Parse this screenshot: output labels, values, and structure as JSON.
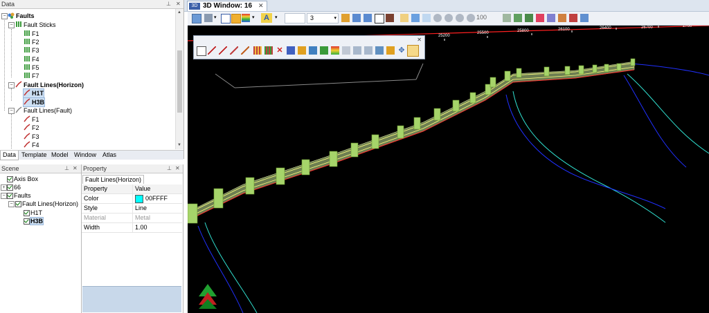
{
  "data_panel": {
    "title": "Data",
    "tree": {
      "root": "Faults",
      "fault_sticks": {
        "label": "Fault Sticks",
        "items": [
          "F1",
          "F2",
          "F3",
          "F4",
          "F5",
          "F7"
        ]
      },
      "fault_lines_horizon": {
        "label": "Fault Lines(Horizon)",
        "items": [
          "H1T",
          "H3B"
        ]
      },
      "fault_lines_fault": {
        "label": "Fault Lines(Fault)",
        "items": [
          "F1",
          "F2",
          "F3",
          "F4"
        ]
      }
    },
    "tabs": [
      "Data",
      "Template",
      "Model",
      "Window",
      "Atlas"
    ]
  },
  "scene_panel": {
    "title": "Scene",
    "items": {
      "axis_box": "Axis Box",
      "n66": "66",
      "faults": "Faults",
      "fault_lines": "Fault Lines(Horizon)",
      "h1t": "H1T",
      "h3b": "H3B"
    }
  },
  "property_panel": {
    "title": "Property",
    "tab": "Fault Lines(Horizon)",
    "headers": {
      "property": "Property",
      "value": "Value"
    },
    "rows": [
      {
        "name": "Color",
        "value": "00FFFF",
        "swatch": "#00ffff"
      },
      {
        "name": "Style",
        "value": "Line"
      },
      {
        "name": "Material",
        "value": "Metal",
        "disabled": true
      },
      {
        "name": "Width",
        "value": "1.00"
      }
    ]
  },
  "window": {
    "tab_title": "3D Window: 16",
    "toolbar": {
      "spin_value": "3",
      "speed_value": "100"
    }
  },
  "viewport": {
    "axis_labels": [
      "25200",
      "25500",
      "25800",
      "26100",
      "26400",
      "26700",
      "2700"
    ],
    "colors": {
      "background": "#000000",
      "fault_band": "#c8e896",
      "fault_box": "#a6d46a",
      "line_red": "#ff2020",
      "line_blue": "#2030ff",
      "line_cyan": "#30e0d0"
    }
  }
}
